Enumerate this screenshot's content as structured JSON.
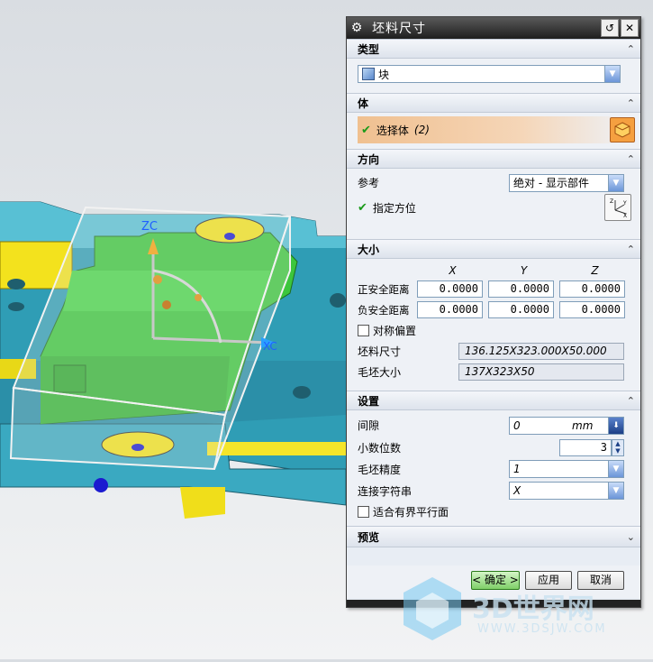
{
  "dialog": {
    "title": "坯料尺寸",
    "type_section": {
      "header": "类型",
      "value": "块"
    },
    "body_section": {
      "header": "体",
      "select_label": "选择体",
      "select_count": "(2)"
    },
    "direction_section": {
      "header": "方向",
      "reference_label": "参考",
      "reference_value": "绝对 - 显示部件",
      "orient_label": "指定方位"
    },
    "size_section": {
      "header": "大小",
      "col_x": "X",
      "col_y": "Y",
      "col_z": "Z",
      "pos_label": "正安全距离",
      "neg_label": "负安全距离",
      "pos_values": [
        "0.0000",
        "0.0000",
        "0.0000"
      ],
      "neg_values": [
        "0.0000",
        "0.0000",
        "0.0000"
      ],
      "symmetric_label": "对称偏置",
      "blank_size_label": "坯料尺寸",
      "blank_size_value": "136.125X323.000X50.000",
      "rough_size_label": "毛坯大小",
      "rough_size_value": "137X323X50"
    },
    "settings_section": {
      "header": "设置",
      "gap_label": "间隙",
      "gap_value": "0",
      "gap_unit": "mm",
      "decimals_label": "小数位数",
      "decimals_value": "3",
      "precision_label": "毛坯精度",
      "precision_value": "1",
      "connector_label": "连接字符串",
      "connector_value": "X",
      "fit_label": "适合有界平行面"
    },
    "preview_section": {
      "header": "预览"
    },
    "buttons": {
      "ok": "< 确定 >",
      "apply": "应用",
      "cancel": "取消"
    }
  },
  "viewport": {
    "zc_label": "ZC",
    "xc_label": "XC"
  },
  "watermark": {
    "brand": "3D世界网",
    "url": "WWW.3DSJW.COM"
  }
}
